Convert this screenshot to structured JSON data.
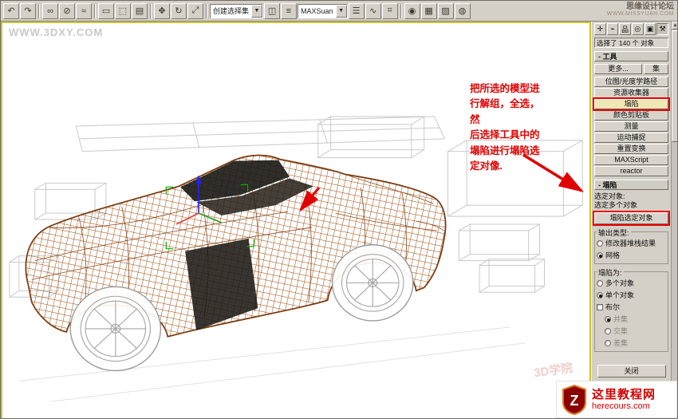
{
  "window": {
    "site_name": "思缘设计论坛",
    "site_url": "WWW.MISSYUAN.COM"
  },
  "toolbar": {
    "icons": [
      {
        "name": "undo",
        "glyph": "↶"
      },
      {
        "name": "redo",
        "glyph": "↷"
      },
      {
        "name": "select-and-link",
        "glyph": "∞"
      },
      {
        "name": "unlink-selection",
        "glyph": "⊘"
      },
      {
        "name": "bind-to-space-warp",
        "glyph": "≈"
      },
      {
        "name": "select-object",
        "glyph": "▭"
      },
      {
        "name": "select-region",
        "glyph": "⬚"
      },
      {
        "name": "select-by-name",
        "glyph": "▤"
      },
      {
        "name": "select-and-move",
        "glyph": "✥"
      },
      {
        "name": "select-and-rotate",
        "glyph": "↻"
      },
      {
        "name": "select-and-scale",
        "glyph": "⤢"
      },
      {
        "name": "mirror",
        "glyph": "◫"
      },
      {
        "name": "align",
        "glyph": "≡"
      },
      {
        "name": "layer-manager",
        "glyph": "☰"
      },
      {
        "name": "curve-editor",
        "glyph": "∿"
      },
      {
        "name": "schematic-view",
        "glyph": "⌗"
      },
      {
        "name": "material-editor",
        "glyph": "◉"
      },
      {
        "name": "render-setup",
        "glyph": "▦"
      },
      {
        "name": "render-frame",
        "glyph": "▨"
      },
      {
        "name": "quick-render",
        "glyph": "◍"
      }
    ],
    "selection_set_combo": "创建选择集",
    "coord_combo": "MAXSuan"
  },
  "viewport": {
    "watermark": "WWW.3DXY.COM",
    "faint_watermark": "3D学院",
    "annotation": "把所选的模型进\n行解组，全选，然\n后选择工具中的\n塌陷进行塌陷选\n定对像."
  },
  "panel": {
    "tabs": [
      {
        "name": "create",
        "glyph": "✛"
      },
      {
        "name": "modify",
        "glyph": "⌁"
      },
      {
        "name": "hierarchy",
        "glyph": "品"
      },
      {
        "name": "motion",
        "glyph": "◎"
      },
      {
        "name": "display",
        "glyph": "▣"
      },
      {
        "name": "utilities",
        "glyph": "⚒"
      }
    ],
    "status": "选择了 140 个 对象",
    "tools_rollout": "- 工具",
    "more_button": "更多...",
    "sets_button": "集",
    "tool_buttons": [
      "位图/光度学路径",
      "资源收集器",
      "塌陷",
      "颜色剪贴板",
      "测量",
      "运动捕捉",
      "重置变换",
      "MAXScript",
      "reactor"
    ],
    "collapse_rollout": "- 塌陷",
    "selected_objects_label": "选定对象:",
    "selected_objects_value": "选定多个对象",
    "collapse_selected_button": "塌陷选定对象",
    "output_type_label": "输出类型:",
    "output_type_options": [
      "修改器堆栈结果",
      "网格"
    ],
    "output_type_selected": "网格",
    "collapse_to_label": "塌陷为:",
    "collapse_to_options": [
      "多个对象",
      "单个对象"
    ],
    "collapse_to_selected": "单个对象",
    "boolean_label": "布尔",
    "boolean_checked": false,
    "boolean_options": [
      "并集",
      "交集",
      "差集"
    ],
    "boolean_selected": "并集",
    "close_button": "关闭"
  },
  "logo": {
    "mark": "Z",
    "title": "这里教程网",
    "url": "herecours.com"
  },
  "colors": {
    "annotation_red": "#e00000",
    "wireframe_brown": "#9a5420",
    "active_viewport_border": "#cdc42f",
    "highlight_button": "#efe7b6"
  }
}
